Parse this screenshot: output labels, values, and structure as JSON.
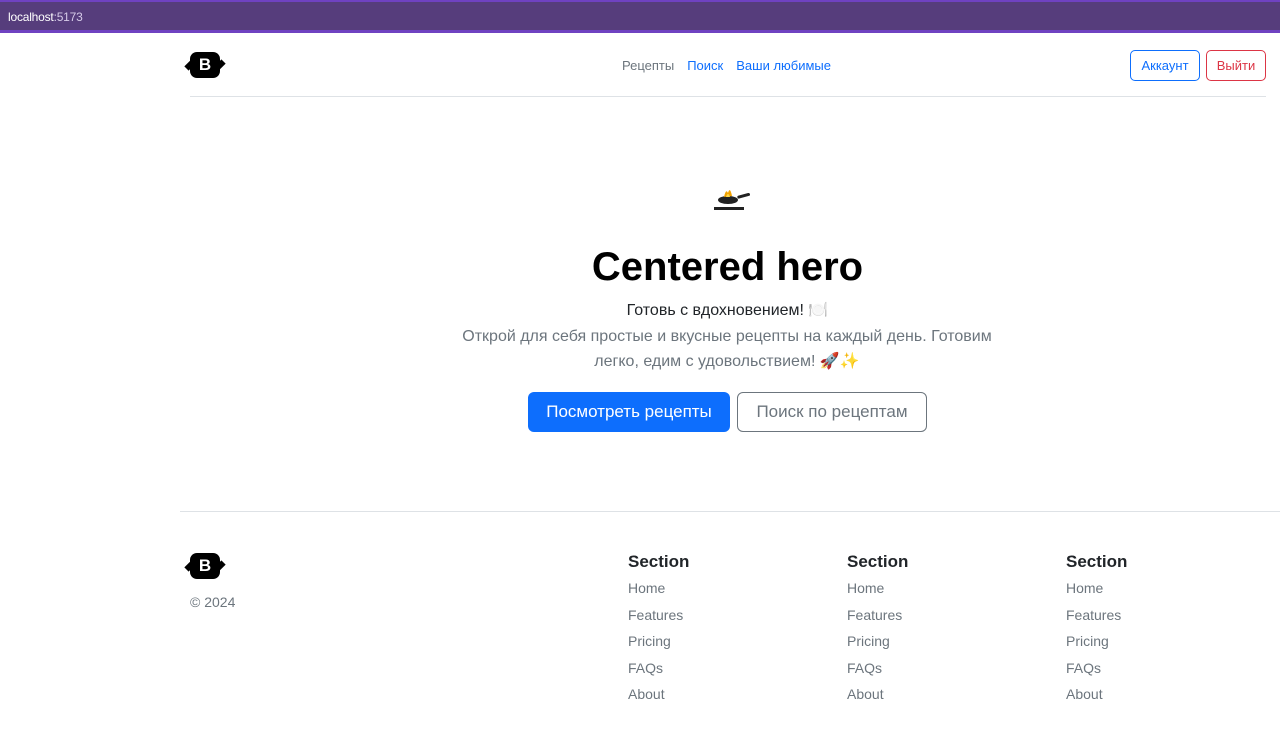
{
  "browser": {
    "host": "localhost",
    "port": ":5173"
  },
  "navbar": {
    "logo_letter": "B",
    "links": [
      "Рецепты",
      "Поиск",
      "Ваши любимые"
    ],
    "account_label": "Аккаунт",
    "logout_label": "Выйти"
  },
  "hero": {
    "title": "Centered hero",
    "subtitle": "Готовь с вдохновением! 🍽️",
    "lead": "Открой для себя простые и вкусные рецепты на каждый день. Готовим легко, едим с удовольствием! 🚀✨",
    "primary_button": "Посмотреть рецепты",
    "secondary_button": "Поиск по рецептам"
  },
  "footer": {
    "logo_letter": "B",
    "copyright": "© 2024",
    "sections": [
      {
        "title": "Section",
        "links": [
          "Home",
          "Features",
          "Pricing",
          "FAQs",
          "About"
        ]
      },
      {
        "title": "Section",
        "links": [
          "Home",
          "Features",
          "Pricing",
          "FAQs",
          "About"
        ]
      },
      {
        "title": "Section",
        "links": [
          "Home",
          "Features",
          "Pricing",
          "FAQs",
          "About"
        ]
      }
    ]
  },
  "colors": {
    "primary": "#0d6efd",
    "danger": "#dc3545",
    "muted": "#6c757d",
    "browser_bar": "#563d7c"
  }
}
